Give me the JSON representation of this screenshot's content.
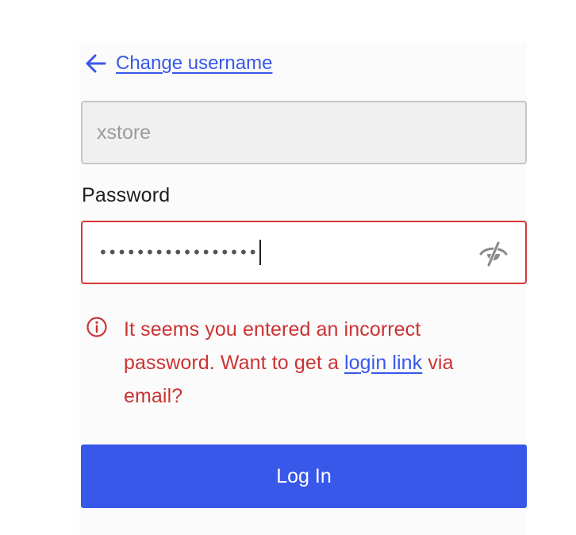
{
  "nav": {
    "back_label": "Change username",
    "back_icon": "arrow-left-icon"
  },
  "username": {
    "value": "xstore"
  },
  "password": {
    "label": "Password",
    "masked_value": "•••••••••••••••••",
    "toggle_icon": "eye-hidden-icon",
    "state": "error"
  },
  "error": {
    "icon": "info-circle-icon",
    "text_before": "It seems you entered an incorrect password. Want to get a ",
    "link_text": "login link",
    "text_after": " via email?"
  },
  "submit": {
    "label": "Log In"
  },
  "colors": {
    "accent": "#3858e9",
    "error": "#cc3333",
    "error_border": "#d63638"
  }
}
